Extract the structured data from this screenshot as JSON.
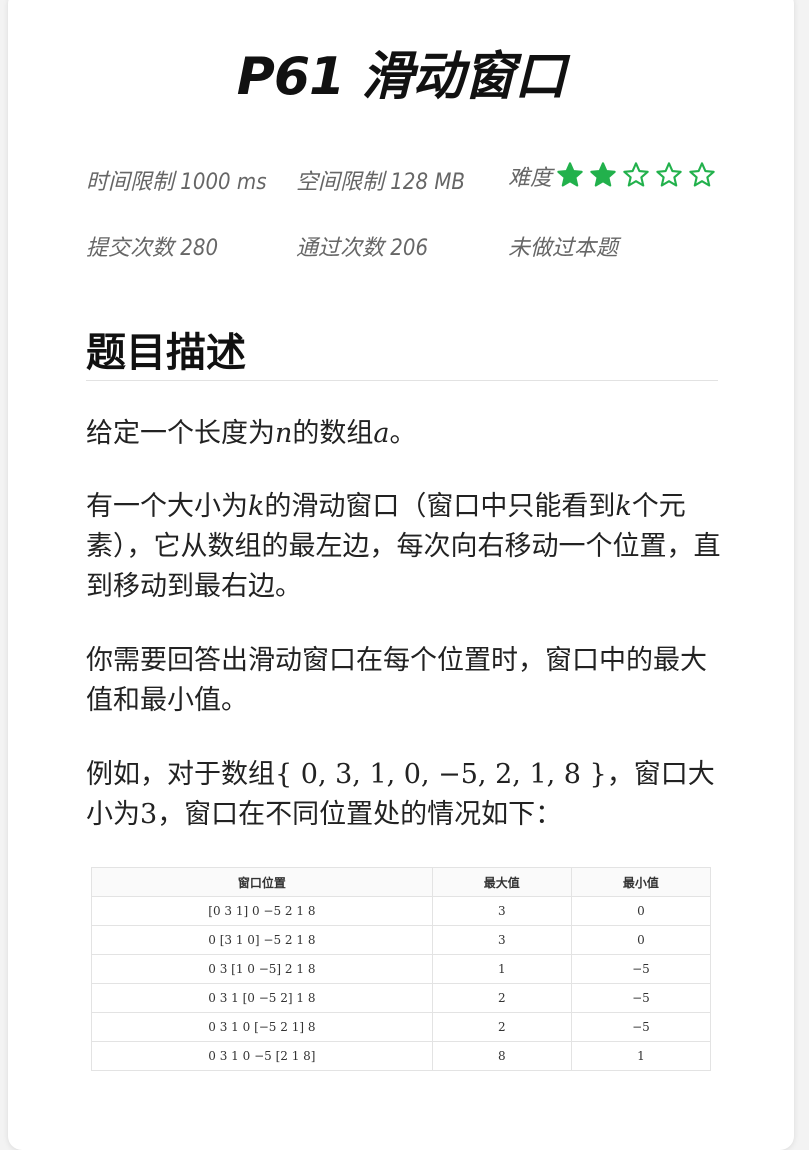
{
  "title": "P61 滑动窗口",
  "meta": {
    "time_limit": "时间限制 1000 ms",
    "memory_limit": "空间限制 128 MB",
    "difficulty_label": "难度",
    "difficulty_level": 2,
    "difficulty_max": 5,
    "star_color": "#22b14c",
    "submissions": "提交次数 280",
    "accepted": "通过次数 206",
    "status": "未做过本题"
  },
  "description": {
    "heading": "题目描述",
    "p1": {
      "a": "给定一个长度为",
      "n": "n",
      "b": "的数组",
      "arr": "a",
      "c": "。"
    },
    "p2": {
      "a": "有一个大小为",
      "k1": "k",
      "b": "的滑动窗口（窗口中只能看到",
      "k2": "k",
      "c": "个元素），它从数组的最左边，每次向右移动一个位置，直到移动到最右边。"
    },
    "p3": "你需要回答出滑动窗口在每个位置时，窗口中的最大值和最小值。",
    "p4": {
      "a": "例如，对于数组",
      "arr": "{ 0, 3, 1, 0, −5, 2, 1, 8 }",
      "b": "，窗口大小为",
      "size": "3",
      "c": "，窗口在不同位置处的情况如下："
    }
  },
  "table": {
    "headers": [
      "窗口位置",
      "最大值",
      "最小值"
    ],
    "rows": [
      [
        "[0 3 1] 0  −5 2 1 8",
        "3",
        "0"
      ],
      [
        "0 [3 1 0]  −5 2 1 8",
        "3",
        "0"
      ],
      [
        "0 3 [1 0  −5] 2 1 8",
        "1",
        "−5"
      ],
      [
        "0 3 1 [0  −5 2] 1 8",
        "2",
        "−5"
      ],
      [
        "0 3 1 0 [−5 2 1] 8",
        "2",
        "−5"
      ],
      [
        "0 3 1 0  −5 [2 1 8]",
        "8",
        "1"
      ]
    ]
  }
}
